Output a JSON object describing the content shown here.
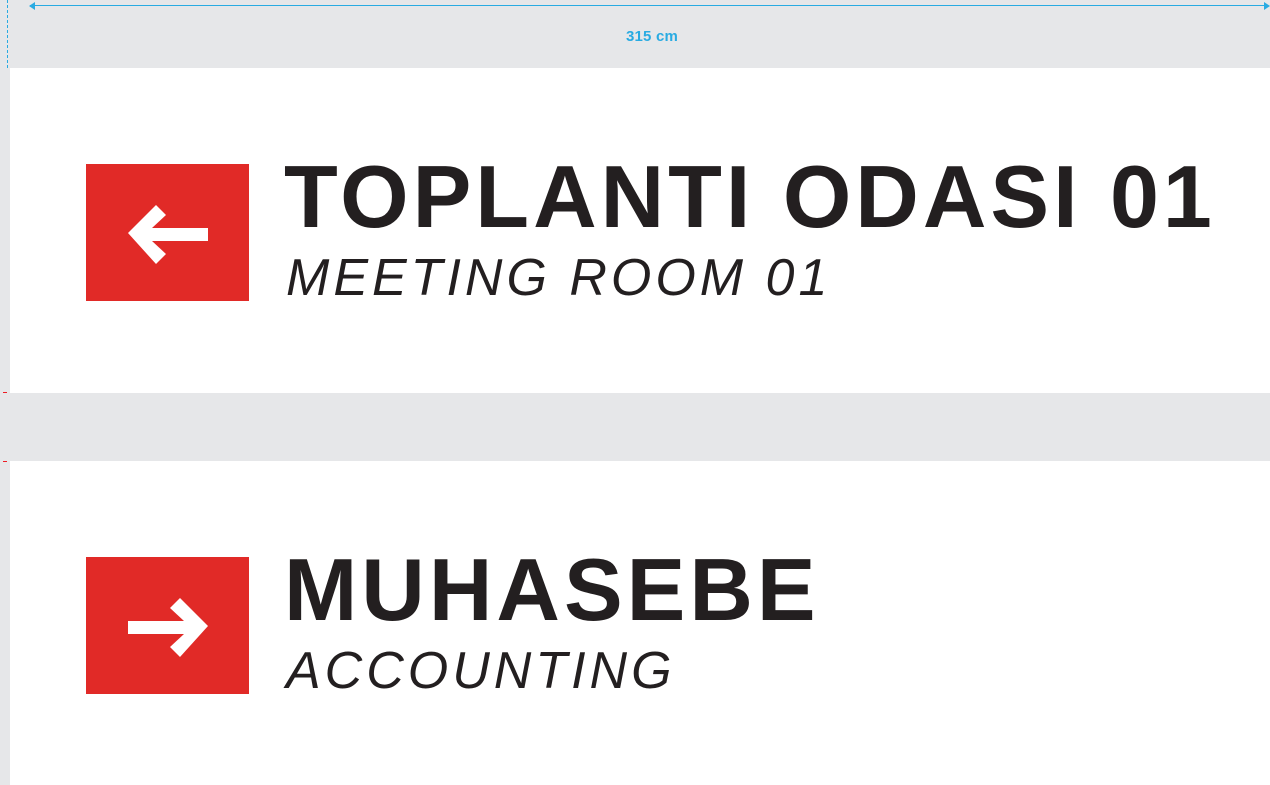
{
  "dimension": {
    "label": "315 cm"
  },
  "signs": [
    {
      "direction": "left-arrow-icon",
      "title": "TOPLANTI ODASI 01",
      "subtitle": "MEETING ROOM 01"
    },
    {
      "direction": "right-arrow-icon",
      "title": "MUHASEBE",
      "subtitle": "ACCOUNTING"
    }
  ],
  "colors": {
    "accent": "#e12a27",
    "text": "#231f20",
    "dimension": "#29abe2",
    "background": "#e6e7e9"
  }
}
